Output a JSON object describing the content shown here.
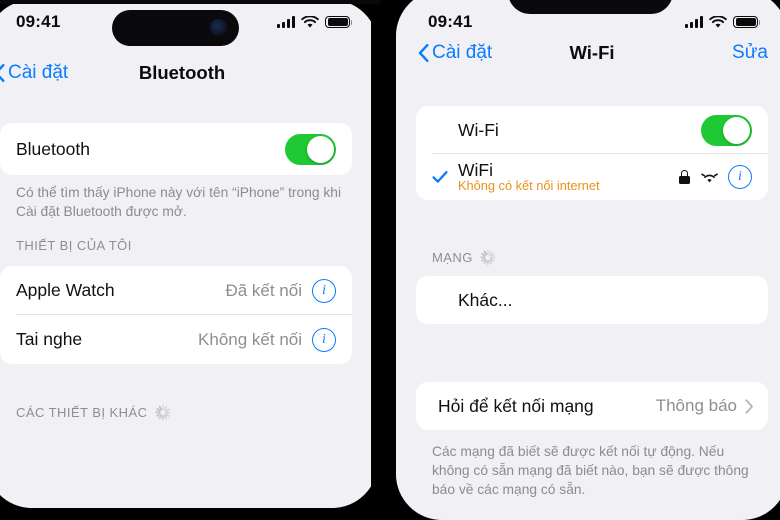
{
  "meta": {
    "accent_blue": "#0a7cff",
    "toggle_green": "#1fc933",
    "warn_orange": "#e8931c",
    "bg_grouped": "#f1f1f5",
    "card_white": "#ffffff",
    "secondary_gray": "#8e8e93"
  },
  "left_phone": {
    "status_bar": {
      "time": "09:41",
      "cellular_icon": "cellular-bars-icon",
      "wifi_icon": "wifi-icon",
      "battery_icon": "battery-full-icon"
    },
    "nav": {
      "back_label": "Cài đặt",
      "back_icon": "chevron-left-icon",
      "title": "Bluetooth"
    },
    "bluetooth_toggle": {
      "label": "Bluetooth",
      "state": "on"
    },
    "description": "Có thể tìm thấy iPhone này với tên “iPhone” trong khi Cài đặt Bluetooth được mở.",
    "my_devices_header": "THIẾT BỊ CỦA TÔI",
    "devices": [
      {
        "name": "Apple Watch",
        "status": "Đã kết nối",
        "info_icon": "info-circle-icon"
      },
      {
        "name": "Tai nghe",
        "status": "Không kết nối",
        "info_icon": "info-circle-icon"
      }
    ],
    "other_devices_header": "CÁC THIẾT BỊ KHÁC",
    "other_devices_spinner": "loading-spinner-icon"
  },
  "right_phone": {
    "status_bar": {
      "time": "09:41",
      "cellular_icon": "cellular-bars-icon",
      "wifi_icon": "wifi-icon",
      "battery_icon": "battery-full-icon"
    },
    "nav": {
      "back_label": "Cài đặt",
      "back_icon": "chevron-left-icon",
      "title": "Wi-Fi",
      "action_label": "Sửa"
    },
    "wifi_toggle": {
      "label": "Wi-Fi",
      "state": "on"
    },
    "connected_network": {
      "check_icon": "checkmark-icon",
      "ssid": "WiFi",
      "subtitle": "Không có kết nối internet",
      "lock_icon": "lock-icon",
      "signal_icon": "wifi-signal-icon",
      "info_icon": "info-circle-icon"
    },
    "networks_header": "MẠNG",
    "networks_spinner": "loading-spinner-icon",
    "other_network_label": "Khác...",
    "ask_to_join": {
      "label": "Hỏi để kết nối mạng",
      "value": "Thông báo",
      "chevron_icon": "chevron-right-icon"
    },
    "footnote": "Các mạng đã biết sẽ được kết nối tự động. Nếu không có sẵn mạng đã biết nào, bạn sẽ được thông báo về các mạng có sẵn."
  }
}
